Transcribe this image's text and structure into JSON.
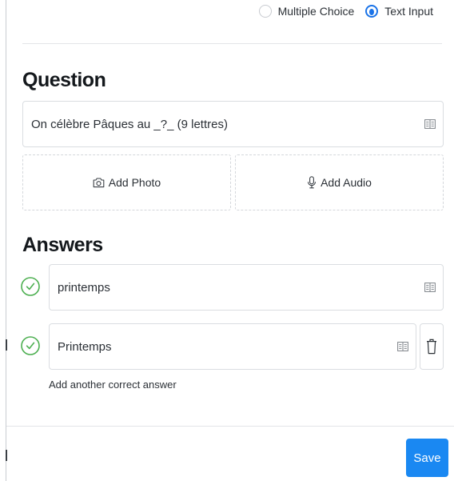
{
  "mode_options": {
    "multiple_choice_label": "Multiple Choice",
    "text_input_label": "Text Input",
    "selected": "Text Input"
  },
  "question": {
    "heading": "Question",
    "text": "On célèbre Pâques au _?_ (9 lettres)",
    "add_photo_label": "Add Photo",
    "add_audio_label": "Add Audio"
  },
  "answers": {
    "heading": "Answers",
    "items": [
      {
        "value": "printemps",
        "correct": true
      },
      {
        "value": "Printemps",
        "correct": true
      }
    ],
    "add_another_label": "Add another correct answer"
  },
  "footer": {
    "save_label": "Save"
  },
  "colors": {
    "accent": "#1a88f2",
    "radio_selected": "#1a73e8",
    "correct_check": "#4caf50"
  }
}
